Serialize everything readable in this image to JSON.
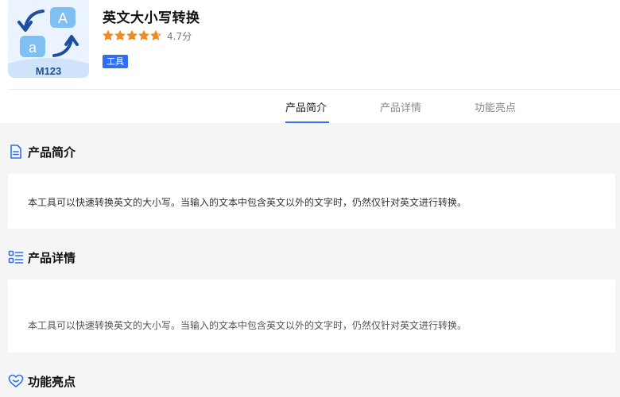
{
  "app": {
    "title": "英文大小写转换",
    "rating_text": "4.7分",
    "rating": 4.7,
    "tag": "工具",
    "icon_label": "M123",
    "icon_letters": [
      "A",
      "a"
    ]
  },
  "tabs": [
    {
      "label": "产品简介",
      "active": true
    },
    {
      "label": "产品详情",
      "active": false
    },
    {
      "label": "功能亮点",
      "active": false
    }
  ],
  "sections": {
    "intro": {
      "title": "产品简介",
      "icon": "document-icon",
      "text": "本工具可以快速转换英文的大小写。当输入的文本中包含英文以外的文字时，仍然仅针对英文进行转换。"
    },
    "details": {
      "title": "产品详情",
      "icon": "list-icon",
      "text": "本工具可以快速转换英文的大小写。当输入的文本中包含英文以外的文字时，仍然仅针对英文进行转换。"
    },
    "highlights": {
      "title": "功能亮点",
      "icon": "heart-icon"
    }
  },
  "colors": {
    "accent": "#2f6ff0",
    "star": "#f08a24",
    "background": "#f5f5f5"
  }
}
